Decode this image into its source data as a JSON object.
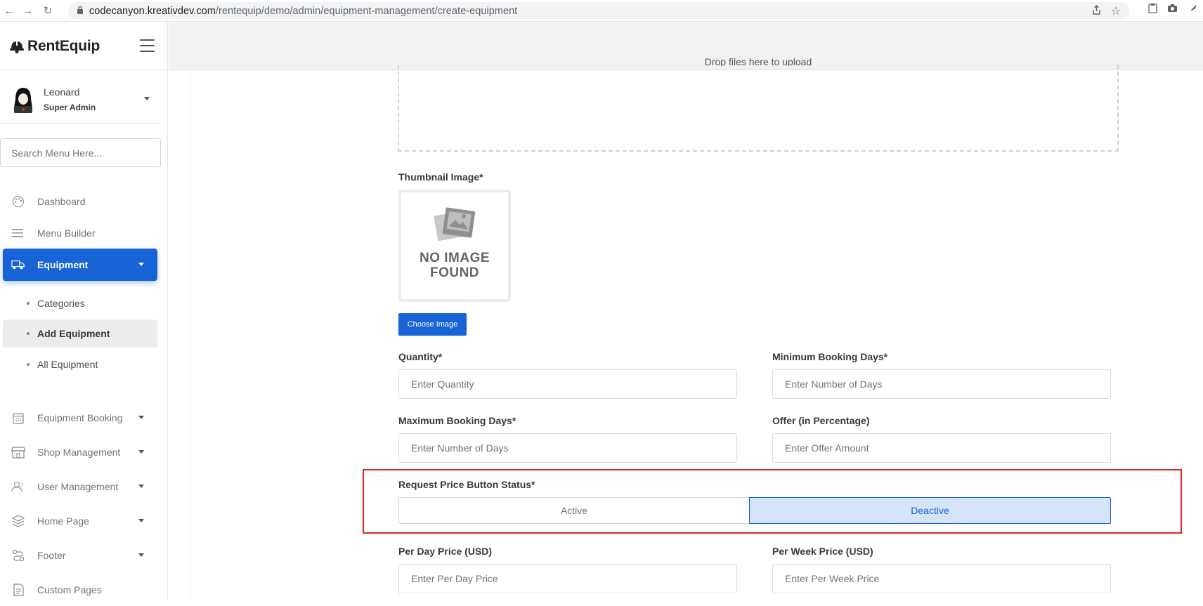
{
  "browser": {
    "url_host": "codecanyon.kreativdev.com",
    "url_path": "/rentequip/demo/admin/equipment-management/create-equipment"
  },
  "brand": {
    "name": "RentEquip"
  },
  "user": {
    "name": "Leonard",
    "role": "Super Admin"
  },
  "search": {
    "placeholder": "Search Menu Here..."
  },
  "sidebar": {
    "items": [
      {
        "label": "Dashboard",
        "icon": "palette-icon"
      },
      {
        "label": "Menu Builder",
        "icon": "bars-icon"
      },
      {
        "label": "Equipment",
        "icon": "truck-icon"
      },
      {
        "label": "Equipment Booking",
        "icon": "calendar-icon"
      },
      {
        "label": "Shop Management",
        "icon": "store-icon"
      },
      {
        "label": "User Management",
        "icon": "users-icon"
      },
      {
        "label": "Home Page",
        "icon": "layers-icon"
      },
      {
        "label": "Footer",
        "icon": "route-icon"
      },
      {
        "label": "Custom Pages",
        "icon": "file-icon"
      }
    ],
    "equipment_sub": [
      {
        "label": "Categories"
      },
      {
        "label": "Add Equipment"
      },
      {
        "label": "All Equipment"
      }
    ]
  },
  "form": {
    "dropzone_text": "Drop files here to upload",
    "thumbnail_label": "Thumbnail Image*",
    "no_image_line1": "NO IMAGE",
    "no_image_line2": "FOUND",
    "choose_image": "Choose Image",
    "quantity_label": "Quantity*",
    "quantity_placeholder": "Enter Quantity",
    "min_days_label": "Minimum Booking Days*",
    "min_days_placeholder": "Enter Number of Days",
    "max_days_label": "Maximum Booking Days*",
    "max_days_placeholder": "Enter Number of Days",
    "offer_label": "Offer (in Percentage)",
    "offer_placeholder": "Enter Offer Amount",
    "request_price_label": "Request Price Button Status*",
    "status_active": "Active",
    "status_deactive": "Deactive",
    "status_selected": "Deactive",
    "per_day_label": "Per Day Price (USD)",
    "per_day_placeholder": "Enter Per Day Price",
    "per_week_label": "Per Week Price (USD)",
    "per_week_placeholder": "Enter Per Week Price"
  },
  "colors": {
    "primary": "#1863d6",
    "highlight": "#e02424",
    "selected_bg": "#d4e3f8"
  }
}
